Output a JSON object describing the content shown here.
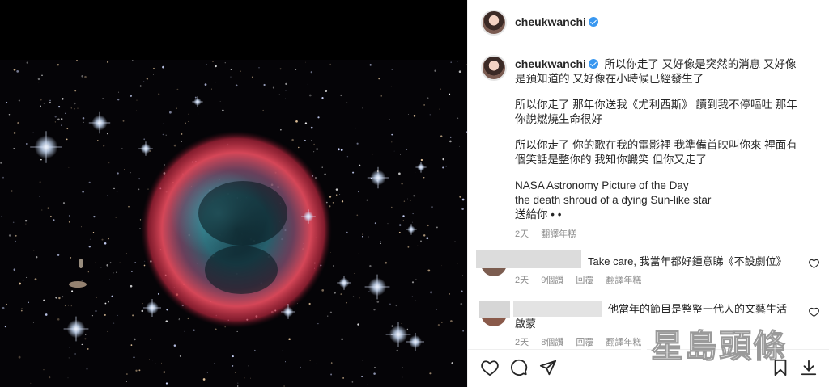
{
  "post": {
    "username": "cheukwanchi",
    "caption": {
      "line1": "所以你走了 又好像是突然的消息 又好像是預知道的 又好像在小時候已經發生了",
      "line2": "所以你走了 那年你送我《尤利西斯》 讀到我不停嘔吐 那年你說燃燒生命很好",
      "line3": "所以你走了 你的歌在我的電影裡 我準備首映叫你來 裡面有個笑話是整你的 我知你識笑 但你又走了",
      "line4": "NASA Astronomy Picture of the Day",
      "line5": "the death shroud of a dying Sun-like star",
      "line6": "送給你 • •"
    },
    "caption_meta": {
      "time": "2天",
      "translate": "翻譯年糕"
    }
  },
  "comments": [
    {
      "text": "Take care, 我當年都好鍾意睇《不設劇位》",
      "time": "2天",
      "likes": "9個讚",
      "reply": "回覆",
      "translate": "翻譯年糕"
    },
    {
      "text": "他當年的節目是整整一代人的文藝生活啟蒙",
      "time": "2天",
      "likes": "8個讚",
      "reply": "回覆",
      "translate": "翻譯年糕"
    }
  ],
  "watermark": {
    "text": "星島頭條"
  },
  "icons": [
    "verified-badge",
    "heart-icon",
    "comment-icon",
    "share-icon",
    "bookmark-icon",
    "download-icon"
  ]
}
